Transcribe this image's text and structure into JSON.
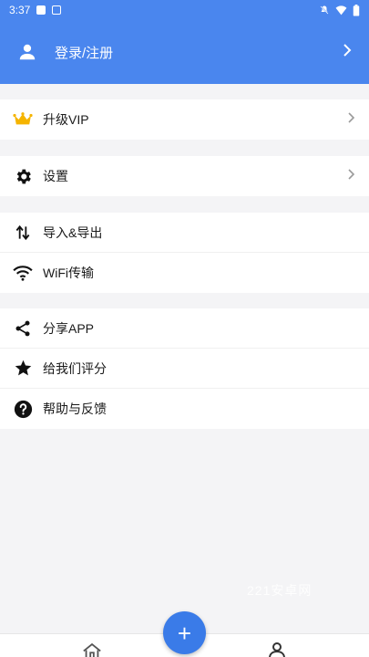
{
  "status_bar": {
    "time": "3:37"
  },
  "header": {
    "login_label": "登录/注册"
  },
  "colors": {
    "primary": "#4a86ee",
    "fab": "#3a7be8",
    "crown": "#f5b400",
    "background": "#f4f4f6"
  },
  "menu": {
    "vip": {
      "label": "升级VIP",
      "icon": "crown-icon"
    },
    "settings": {
      "label": "设置",
      "icon": "gear-icon"
    },
    "import_export": {
      "label": "导入&导出",
      "icon": "swap-vertical-icon"
    },
    "wifi": {
      "label": "WiFi传输",
      "icon": "wifi-icon"
    },
    "share": {
      "label": "分享APP",
      "icon": "share-icon"
    },
    "rate": {
      "label": "给我们评分",
      "icon": "star-icon"
    },
    "help": {
      "label": "帮助与反馈",
      "icon": "help-circle-icon"
    }
  },
  "watermark": "221安卓网",
  "fab": {
    "symbol": "+"
  },
  "bottom_nav": {
    "home_icon": "home-icon",
    "profile_icon": "person-icon"
  }
}
